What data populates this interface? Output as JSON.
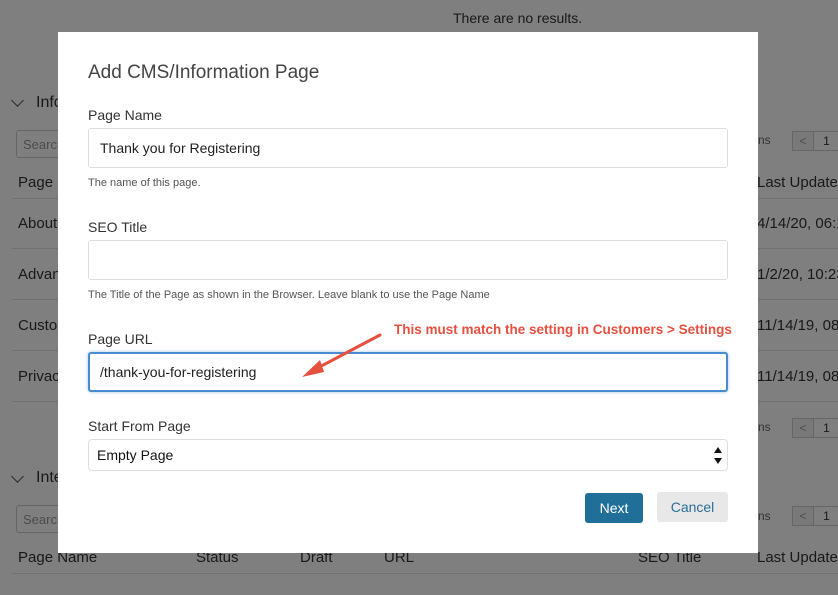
{
  "background": {
    "no_results_text": "There are no results.",
    "section1_title_partial": "Info",
    "section2_title_partial": "Inte",
    "search_placeholder": "Search",
    "items_partial": "ns",
    "page_number": "1",
    "pager_prev": "<",
    "table1": {
      "col_page_partial": "Page N",
      "col_last_updated": "Last Updated",
      "rows": [
        {
          "name_partial": "About",
          "updated_partial": "4/14/20, 06:1"
        },
        {
          "name_partial": "Advan",
          "updated_partial": "1/2/20, 10:23"
        },
        {
          "name_partial": "Custo",
          "updated_partial": "11/14/19, 08"
        },
        {
          "name_partial": "Privac",
          "updated_partial": "11/14/19, 08"
        }
      ]
    },
    "table2": {
      "columns": [
        "Page Name",
        "Status",
        "Draft",
        "URL",
        "SEO Title",
        "Last Updated"
      ]
    }
  },
  "modal": {
    "title": "Add CMS/Information Page",
    "page_name": {
      "label": "Page Name",
      "value": "Thank you for Registering",
      "help": "The name of this page."
    },
    "seo_title": {
      "label": "SEO Title",
      "value": "",
      "help": "The Title of the Page as shown in the Browser. Leave blank to use the Page Name"
    },
    "page_url": {
      "label": "Page URL",
      "value": "/thank-you-for-registering"
    },
    "start_from": {
      "label": "Start From Page",
      "selected": "Empty Page"
    },
    "next_label": "Next",
    "cancel_label": "Cancel"
  },
  "annotation": {
    "text": "This must match the setting in Customers > Settings",
    "color": "#e5503f"
  },
  "colors": {
    "primary_button": "#1f6f99",
    "focus_border": "#4a8bd4",
    "overlay": "rgba(0,0,0,0.5)"
  },
  "icons": {
    "collapse": "chevron-down-icon",
    "select": "select-arrows-icon",
    "annotation_arrow": "arrow-icon"
  }
}
